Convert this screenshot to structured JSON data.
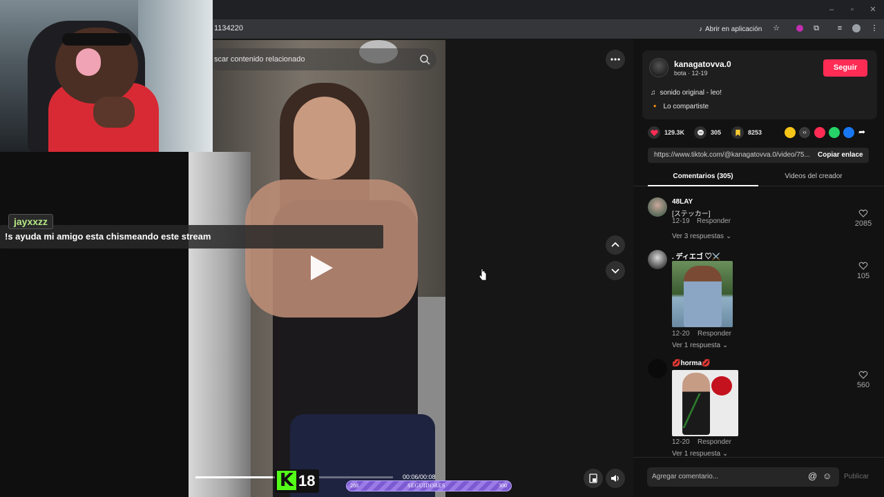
{
  "browser": {
    "url": "1134220",
    "open_app_label": "Abrir en aplicación"
  },
  "video": {
    "search_placeholder": "scar contenido relacionado",
    "time": "00:06/00:08",
    "progress_fraction": 0.39
  },
  "chat": {
    "username": "jayxxzz",
    "message": "!s ayuda mi amigo esta chismeando este stream"
  },
  "kick": {
    "count": "18"
  },
  "follower_goal": {
    "start": "288",
    "label": "SEGUIDORES",
    "end": "300"
  },
  "author": {
    "username": "kanagatovva.0",
    "subline": "bota · 12-19",
    "follow_label": "Seguir",
    "sound": "sonido original - leo!",
    "shared": "Lo compartiste"
  },
  "stats": {
    "likes": "129.3K",
    "comments": "305",
    "saves": "8253"
  },
  "link": {
    "url": "https://www.tiktok.com/@kanagatovva.0/video/75...",
    "copy_label": "Copiar enlace"
  },
  "tabs": {
    "comments": "Comentarios (305)",
    "videos": "Videos del creador"
  },
  "comments": [
    {
      "user": "48LAY",
      "text": "[ステッカー]",
      "date": "12-19",
      "reply": "Responder",
      "replies": "Ver 3 respuestas",
      "likes": "2085"
    },
    {
      "user": ". ディエゴ ♡⚔️",
      "date": "12-20",
      "reply": "Responder",
      "replies": "Ver 1 respuesta",
      "likes": "105"
    },
    {
      "user": "💋horma💋",
      "date": "12-20",
      "reply": "Responder",
      "replies": "Ver 1 respuesta",
      "likes": "560"
    }
  ],
  "comment_bar": {
    "placeholder": "Agregar comentario...",
    "publish": "Publicar"
  },
  "colors": {
    "accent": "#fe2c55",
    "kick_green": "#53fc18",
    "goal_purple": "#7c5ad1"
  }
}
